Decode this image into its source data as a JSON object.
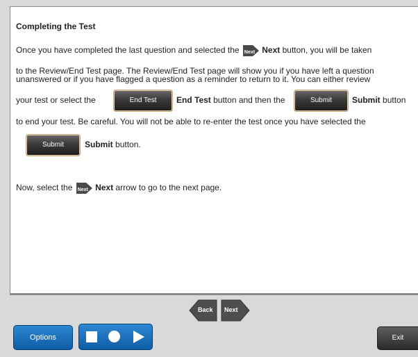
{
  "content": {
    "title": "Completing the Test",
    "line1_pre": "Once you have completed the last question and selected the",
    "next_icon_label": "Next",
    "line1_bold": "Next",
    "line1_post": "button, you will be taken",
    "line2": "to the Review/End Test page. The Review/End Test page will show you if you have left a question",
    "line3": "unanswered or if you have flagged a question as a reminder to return to it. You can either review",
    "line4_pre": "your test or select the",
    "end_test_btn": "End Test",
    "line4_bold1": "End Test",
    "line4_mid": "button and then the",
    "submit_btn": "Submit",
    "line4_bold2": "Submit",
    "line4_post": "button",
    "line5": "to end your test. Be careful. You will not be able to re-enter the test once you have selected the",
    "submit_btn2": "Submit",
    "line6_bold": "Submit",
    "line6_post": "button.",
    "line7_pre": "Now, select the",
    "line7_bold": "Next",
    "line7_post": "arrow to go to the next page."
  },
  "nav": {
    "back_label": "Back",
    "next_label": "Next"
  },
  "bottom_bar": {
    "options_label": "Options",
    "exit_label": "Exit",
    "media_icons": [
      "stop-icon",
      "record-icon",
      "play-icon"
    ]
  },
  "colors": {
    "accent_blue": "#1a70bd",
    "dark_button": "#2a2a2a",
    "panel_bg": "#ffffff",
    "page_bg": "#d9d9d9"
  }
}
